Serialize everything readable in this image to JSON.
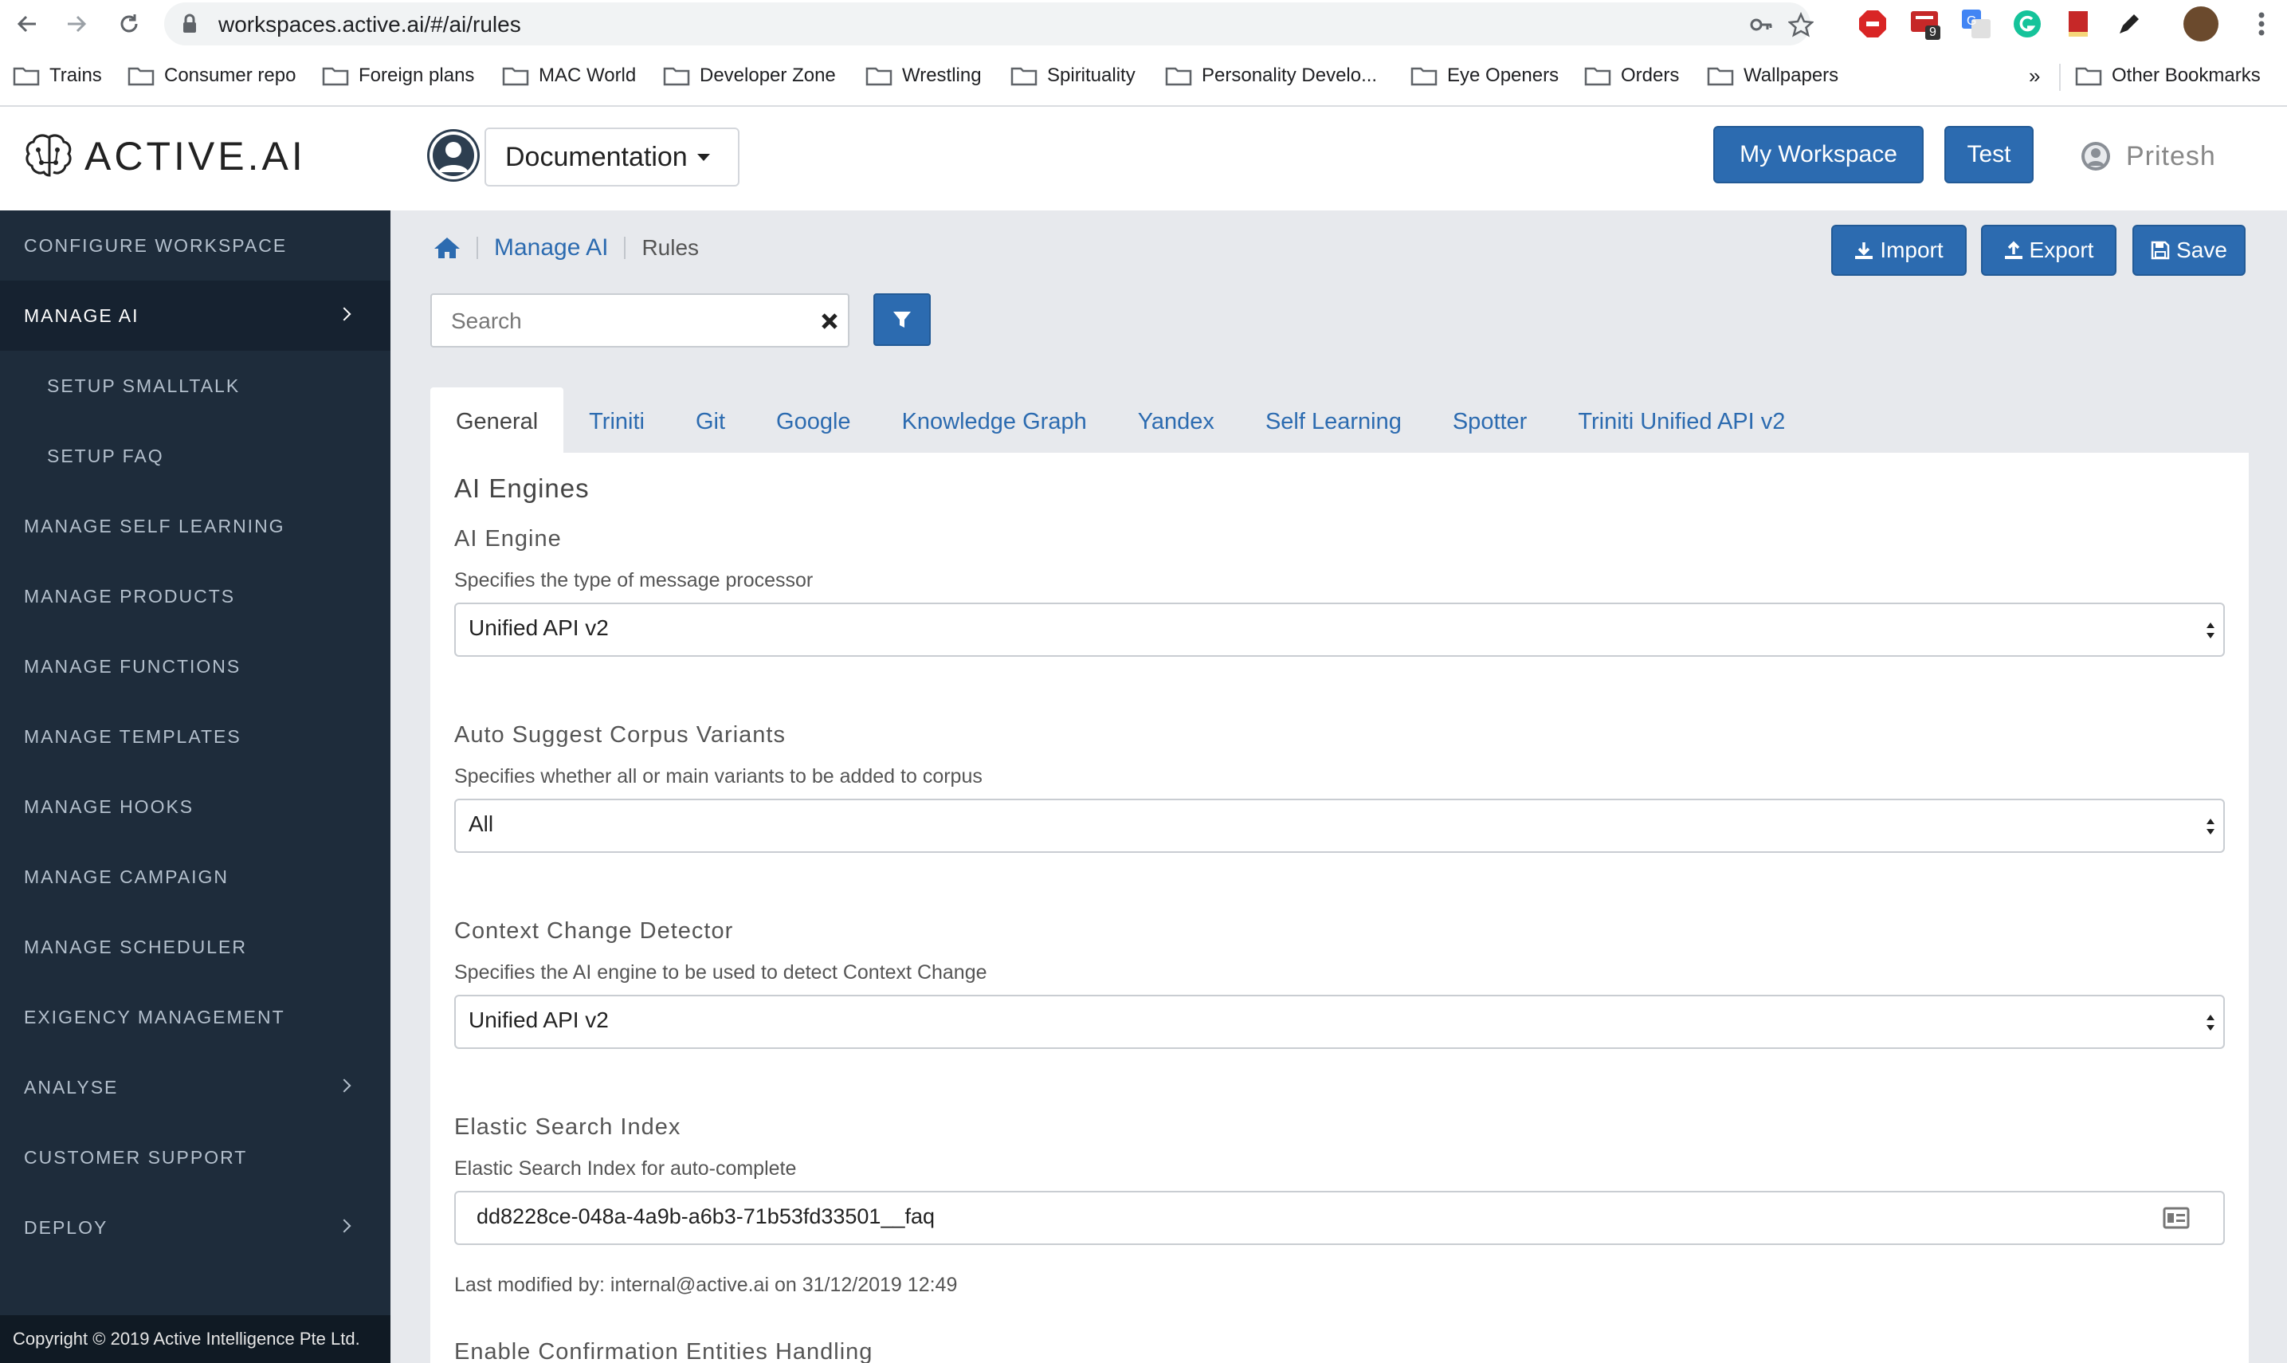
{
  "browser": {
    "url": "workspaces.active.ai/#/ai/rules",
    "extension_badge": "9",
    "bookmarks": [
      "Trains",
      "Consumer repo",
      "Foreign plans",
      "MAC World",
      "Developer Zone",
      "Wrestling",
      "Spirituality",
      "Personality Develo...",
      "Eye Openers",
      "Orders",
      "Wallpapers"
    ],
    "more_bookmarks": "»",
    "other_bookmarks": "Other Bookmarks"
  },
  "header": {
    "brand": "ACTIVE.AI",
    "workspace": "Documentation",
    "my_workspace": "My Workspace",
    "test": "Test",
    "user": "Pritesh"
  },
  "sidebar": {
    "items": [
      {
        "label": "CONFIGURE WORKSPACE"
      },
      {
        "label": "MANAGE AI",
        "active": true,
        "chevron": true
      },
      {
        "label": "SETUP SMALLTALK",
        "sub": true
      },
      {
        "label": "SETUP FAQ",
        "sub": true
      },
      {
        "label": "MANAGE SELF LEARNING"
      },
      {
        "label": "MANAGE PRODUCTS"
      },
      {
        "label": "MANAGE FUNCTIONS"
      },
      {
        "label": "MANAGE TEMPLATES"
      },
      {
        "label": "MANAGE HOOKS"
      },
      {
        "label": "MANAGE CAMPAIGN"
      },
      {
        "label": "MANAGE SCHEDULER"
      },
      {
        "label": "EXIGENCY MANAGEMENT"
      },
      {
        "label": "ANALYSE",
        "chevron": true
      },
      {
        "label": "CUSTOMER SUPPORT"
      },
      {
        "label": "DEPLOY",
        "chevron": true
      }
    ],
    "copyright": "Copyright © 2019 Active Intelligence Pte Ltd."
  },
  "breadcrumb": {
    "parent": "Manage AI",
    "current": "Rules"
  },
  "actions": {
    "import": "Import",
    "export": "Export",
    "save": "Save"
  },
  "search": {
    "placeholder": "Search",
    "value": ""
  },
  "tabs": [
    "General",
    "Triniti",
    "Git",
    "Google",
    "Knowledge Graph",
    "Yandex",
    "Self Learning",
    "Spotter",
    "Triniti Unified API v2"
  ],
  "panel": {
    "heading": "AI Engines",
    "fields": {
      "ai_engine": {
        "label": "AI Engine",
        "help": "Specifies the type of message processor",
        "value": "Unified API v2"
      },
      "auto_suggest": {
        "label": "Auto Suggest Corpus Variants",
        "help": "Specifies whether all or main variants to be added to corpus",
        "value": "All"
      },
      "context_change": {
        "label": "Context Change Detector",
        "help": "Specifies the AI engine to be used to detect Context Change",
        "value": "Unified API v2"
      },
      "elastic_index": {
        "label": "Elastic Search Index",
        "help": "Elastic Search Index for auto-complete",
        "value": "dd8228ce-048a-4a9b-a6b3-71b53fd33501__faq",
        "modified": "Last modified by: internal@active.ai on 31/12/2019 12:49"
      },
      "confirmation_entities": {
        "label": "Enable Confirmation Entities Handling"
      }
    }
  },
  "colors": {
    "primary": "#2c6bb0",
    "sidebar": "#1e2c3b",
    "sidebar_active": "#162230",
    "content_bg": "#e7e9ed"
  }
}
